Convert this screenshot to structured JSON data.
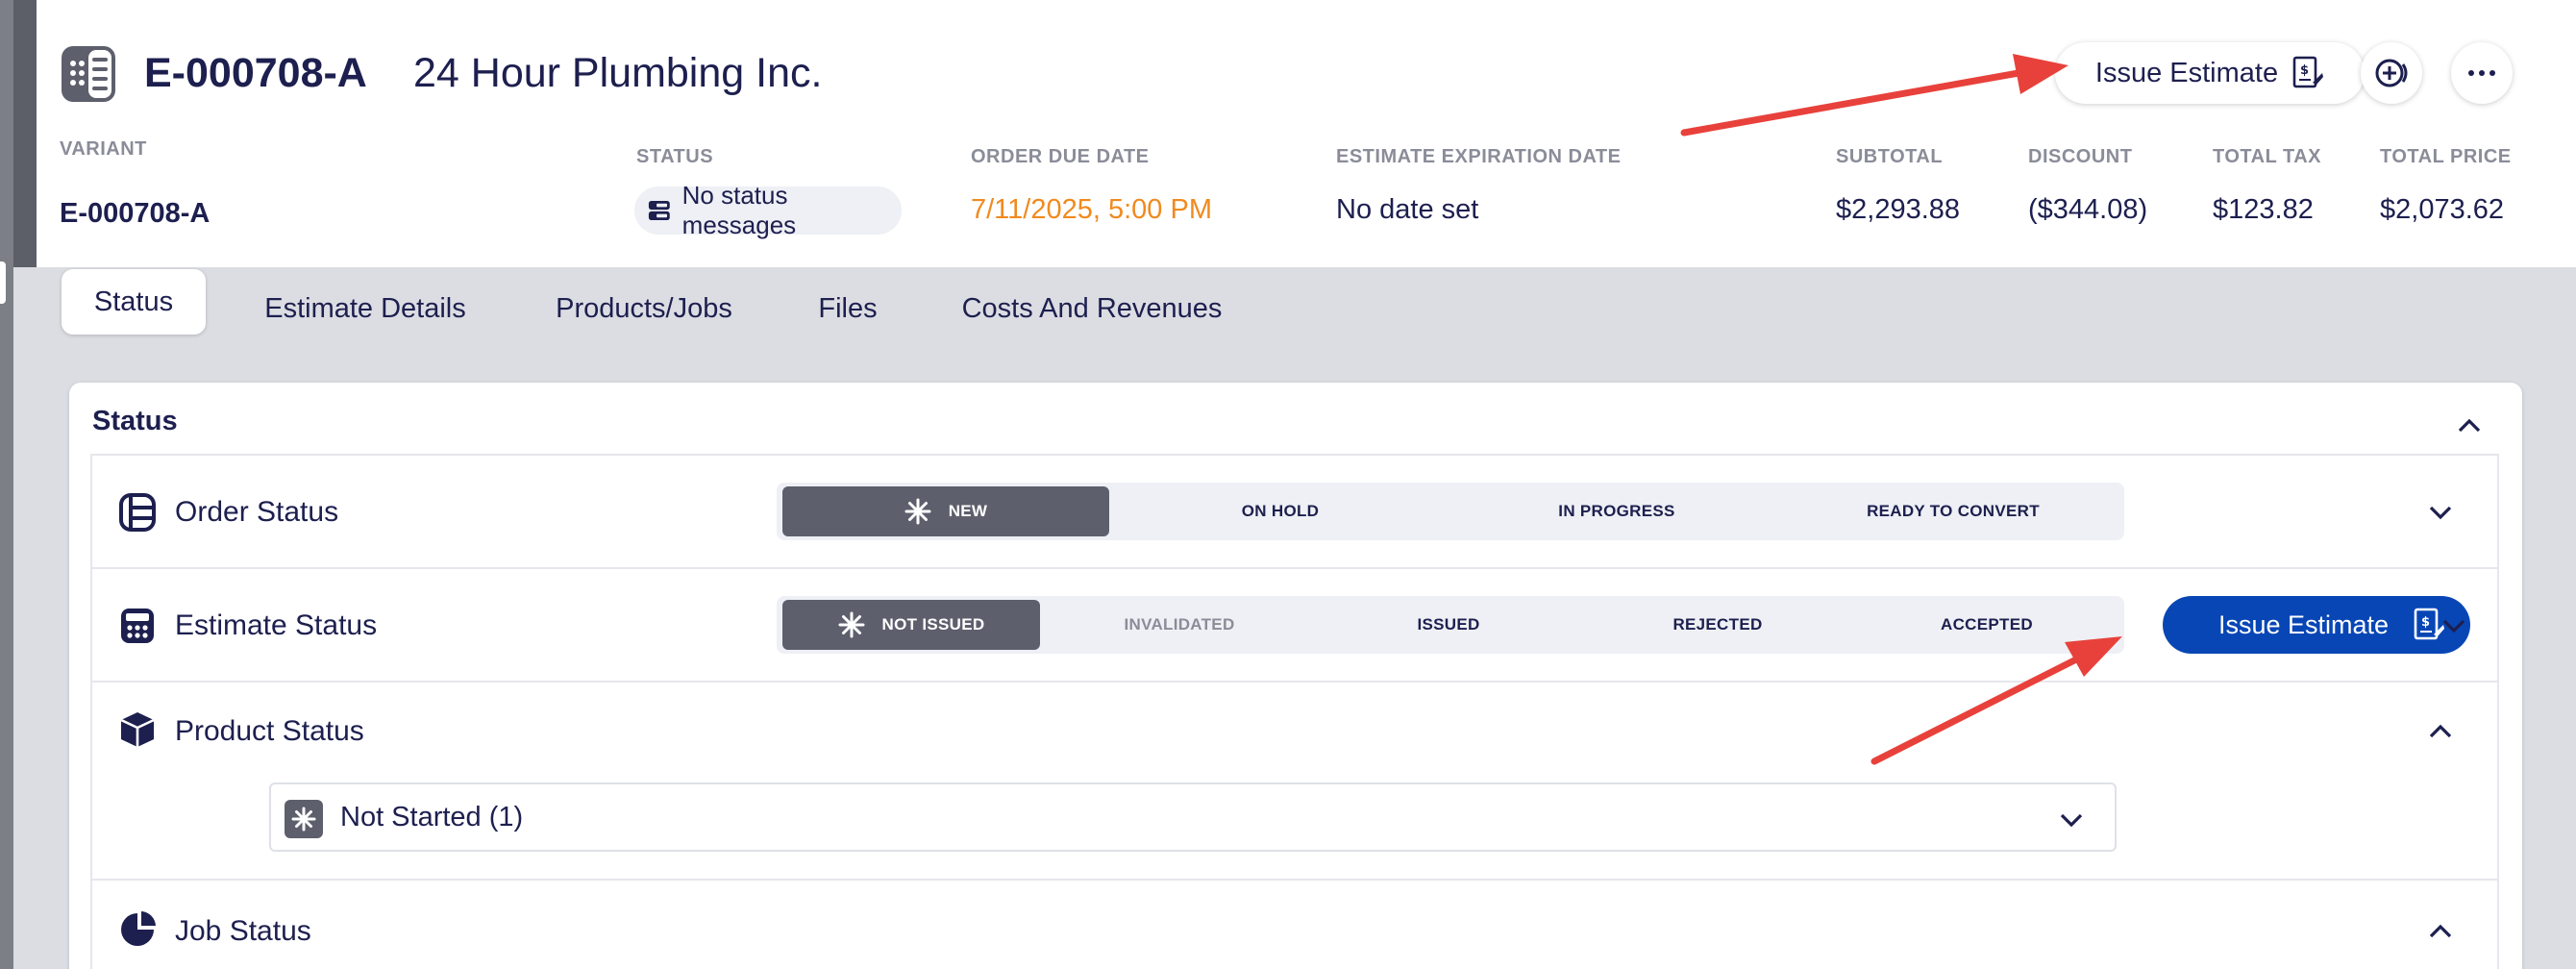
{
  "header": {
    "order_id": "E-000708-A",
    "company": "24 Hour Plumbing Inc.",
    "issue_button_label": "Issue Estimate",
    "meta": {
      "variant_label": "VARIANT",
      "variant_value": "E-000708-A",
      "status_label": "STATUS",
      "status_value": "No status messages",
      "due_label": "ORDER DUE DATE",
      "due_value": "7/11/2025, 5:00 PM",
      "expiration_label": "ESTIMATE EXPIRATION DATE",
      "expiration_value": "No date set",
      "subtotal_label": "SUBTOTAL",
      "subtotal_value": "$2,293.88",
      "discount_label": "DISCOUNT",
      "discount_value": "($344.08)",
      "tax_label": "TOTAL TAX",
      "tax_value": "$123.82",
      "total_label": "TOTAL PRICE",
      "total_value": "$2,073.62"
    }
  },
  "tabs": [
    "Status",
    "Estimate Details",
    "Products/Jobs",
    "Files",
    "Costs And Revenues"
  ],
  "card": {
    "title": "Status",
    "order_status": {
      "title": "Order Status",
      "options": [
        "NEW",
        "ON HOLD",
        "IN PROGRESS",
        "READY TO CONVERT"
      ],
      "selected": "NEW"
    },
    "estimate_status": {
      "title": "Estimate Status",
      "options": [
        "NOT ISSUED",
        "INVALIDATED",
        "ISSUED",
        "REJECTED",
        "ACCEPTED"
      ],
      "selected": "NOT ISSUED",
      "issue_button_label": "Issue Estimate"
    },
    "product_status": {
      "title": "Product Status",
      "select_value": "Not Started (1)"
    },
    "job_status": {
      "title": "Job Status"
    }
  },
  "colors": {
    "accent_blue": "#0846b5",
    "orange_date": "#f08a1e",
    "navy_text": "#1d1f4f",
    "annotation_red": "#e8413b"
  }
}
